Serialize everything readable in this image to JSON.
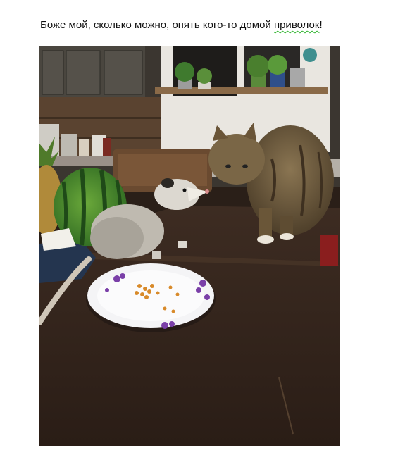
{
  "caption": {
    "text_before": "Боже мой, сколько можно, опять кого-то домой ",
    "text_flagged": "приволок",
    "text_after": "!"
  },
  "photo": {
    "subject": "opossum and cat at a kitchen table with a plate of food",
    "icon": "photo-image"
  },
  "colors": {
    "spellcheck_underline": "#2fb52f",
    "table": "#3a2a20",
    "cabinet": "#4a463f"
  }
}
